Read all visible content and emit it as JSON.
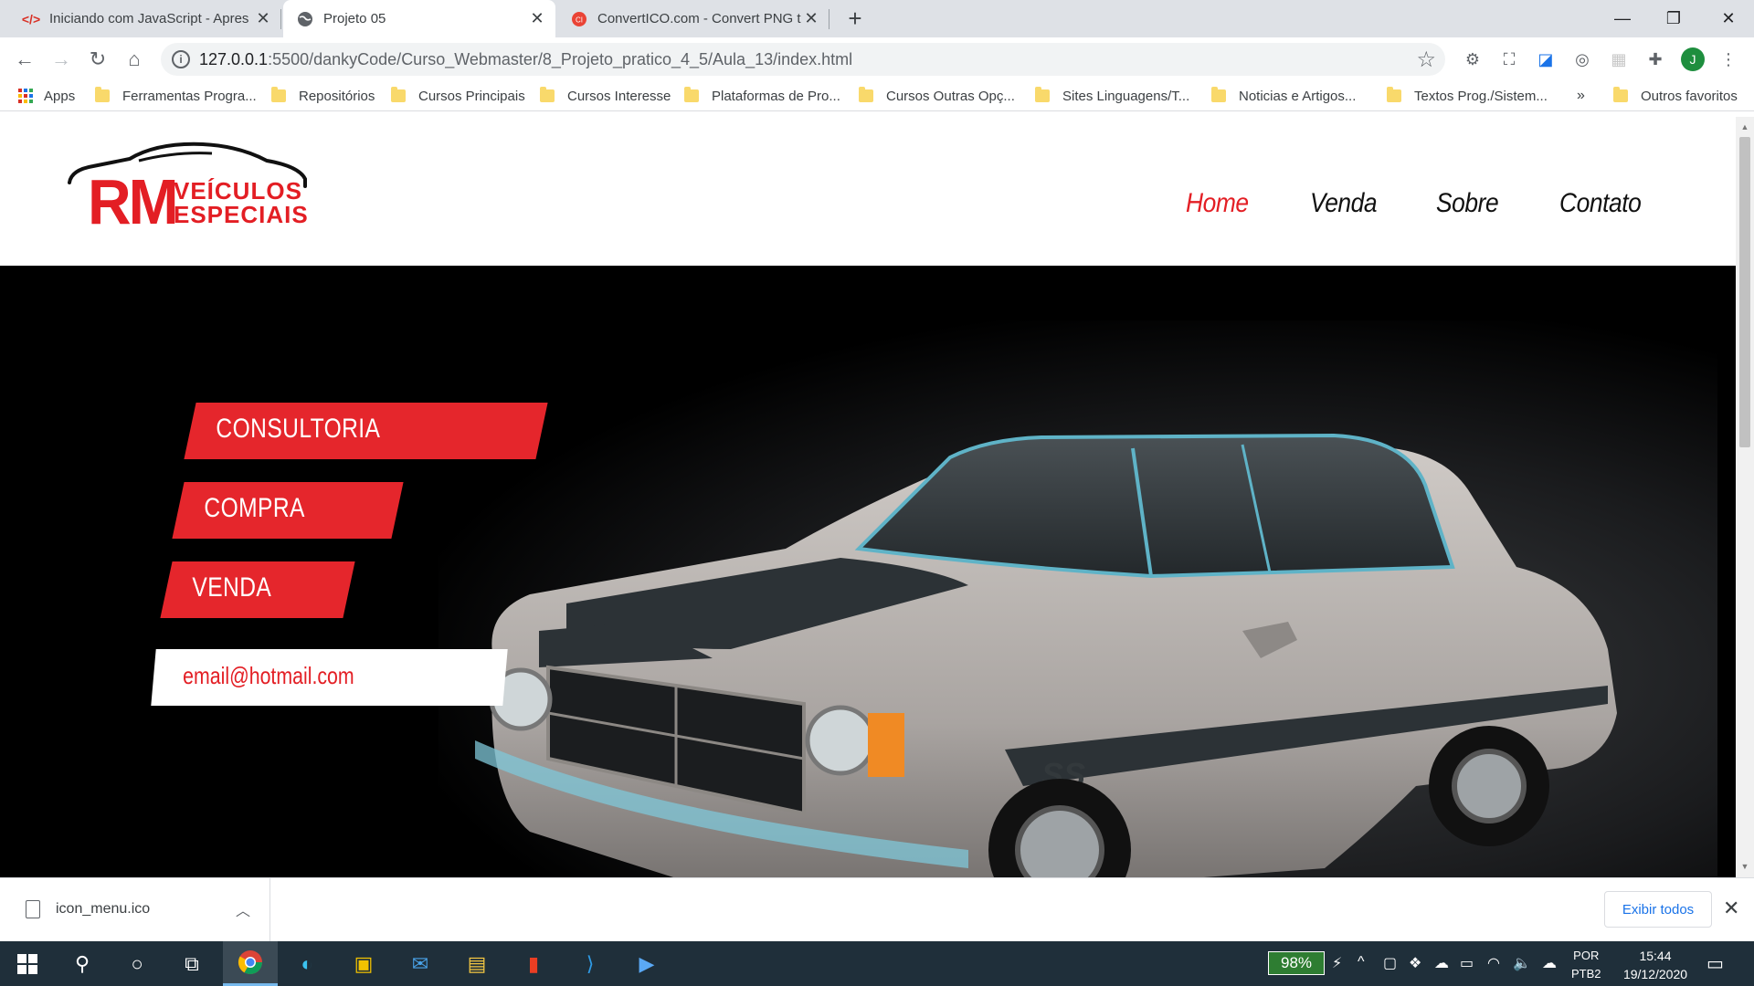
{
  "browser": {
    "tabs": [
      {
        "title": "Iniciando com JavaScript - Apres",
        "icon": "code-icon",
        "active": false
      },
      {
        "title": "Projeto 05",
        "icon": "globe-icon",
        "active": true
      },
      {
        "title": "ConvertICO.com - Convert PNG t",
        "icon": "converter-icon",
        "active": false
      }
    ],
    "new_tab": "+",
    "url_host": "127.0.0.1",
    "url_path": ":5500/dankyCode/Curso_Webmaster/8_Projeto_pratico_4_5/Aula_13/index.html",
    "avatar_letter": "J",
    "bookmarks": [
      "Apps",
      "Ferramentas Progra...",
      "Repositórios",
      "Cursos Principais",
      "Cursos Interesse",
      "Plataformas de Pro...",
      "Cursos Outras Opç...",
      "Sites Linguagens/T...",
      "Noticias e Artigos...",
      "Textos Prog./Sistem..."
    ],
    "more_bookmarks": "»",
    "other_bookmarks": "Outros favoritos"
  },
  "site": {
    "logo_rm": "RM",
    "logo_line1": "VEÍCULOS",
    "logo_line2": "ESPECIAIS",
    "nav": [
      "Home",
      "Venda",
      "Sobre",
      "Contato"
    ],
    "hero_buttons": [
      "CONSULTORIA",
      "COMPRA",
      "VENDA"
    ],
    "hero_email": "email@hotmail.com",
    "accent_color": "#e31e24"
  },
  "downloads": {
    "file_name": "icon_menu.ico",
    "show_all": "Exibir todos"
  },
  "taskbar": {
    "battery": "98%",
    "lang_line1": "POR",
    "lang_line2": "PTB2",
    "time": "15:44",
    "date": "19/12/2020"
  }
}
